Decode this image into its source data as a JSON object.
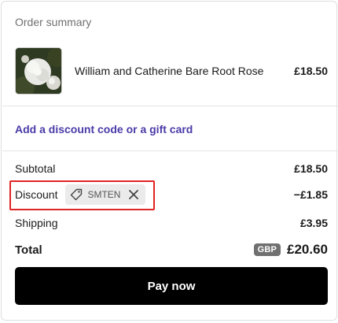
{
  "order_summary": {
    "title": "Order summary",
    "product": {
      "name": "William and Catherine Bare Root Rose",
      "price": "£18.50",
      "thumbnail_icon": "white-rose-image"
    },
    "discount_link": "Add a discount code or a gift card",
    "lines": {
      "subtotal": {
        "label": "Subtotal",
        "value": "£18.50"
      },
      "discount": {
        "label": "Discount",
        "code": "SMTEN",
        "value": "−£1.85",
        "tag_icon": "tag-icon",
        "remove_icon": "close-icon"
      },
      "shipping": {
        "label": "Shipping",
        "value": "£3.95"
      }
    },
    "total": {
      "label": "Total",
      "currency": "GBP",
      "amount": "£20.60"
    },
    "pay_button": "Pay now"
  },
  "colors": {
    "link": "#4a3ba8",
    "highlight_border": "#e02424",
    "pay_button_bg": "#000000",
    "currency_badge_bg": "#707070",
    "code_chip_bg": "#ebebeb"
  }
}
